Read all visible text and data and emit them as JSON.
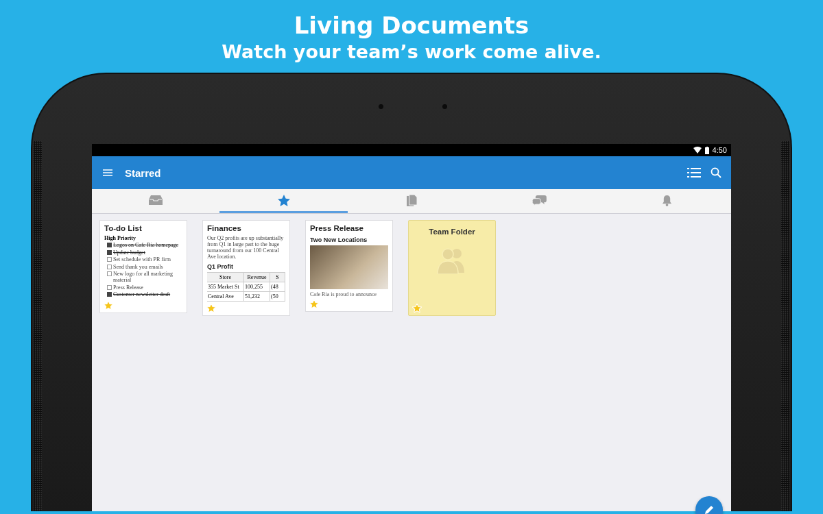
{
  "header": {
    "title": "Living Documents",
    "subtitle": "Watch your team’s work come alive."
  },
  "status_bar": {
    "time": "4:50"
  },
  "app_bar": {
    "title": "Starred"
  },
  "tabs": [
    {
      "kind": "inbox",
      "selected": false
    },
    {
      "kind": "star",
      "selected": true
    },
    {
      "kind": "documents",
      "selected": false
    },
    {
      "kind": "chat",
      "selected": false
    },
    {
      "kind": "bell",
      "selected": false
    }
  ],
  "documents": [
    {
      "kind": "todo",
      "title": "To-do List",
      "starred": true,
      "heading": "High Priority",
      "items": [
        {
          "text": "Logos on Cafe Ria homepage",
          "checked": true
        },
        {
          "text": "Update budget",
          "checked": true
        },
        {
          "text": "Set schedule with PR firm",
          "checked": false
        },
        {
          "text": "Send thank you emails",
          "checked": false
        },
        {
          "text": "New logo for all marketing material",
          "checked": false
        },
        {
          "text": "Press Release",
          "checked": false
        },
        {
          "text": "Customer newsletter draft",
          "checked": true
        }
      ]
    },
    {
      "kind": "sheet",
      "title": "Finances",
      "starred": true,
      "body": "Our Q2 profits are up substantially from Q1 in large part to the huge turnaround from our 100 Central Ave location.",
      "subheading": "Q1 Profit",
      "columns": [
        "Store",
        "Revenue",
        "S"
      ],
      "rows": [
        [
          "355 Market St",
          "100,255",
          "(48"
        ],
        [
          "Central Ave",
          "51,232",
          "(50"
        ]
      ]
    },
    {
      "kind": "press",
      "title": "Press Release",
      "starred": true,
      "subheading": "Two New Locations",
      "body": "Cafe Ria is proud to announce"
    },
    {
      "kind": "folder",
      "title": "Team Folder",
      "starred": true
    }
  ]
}
